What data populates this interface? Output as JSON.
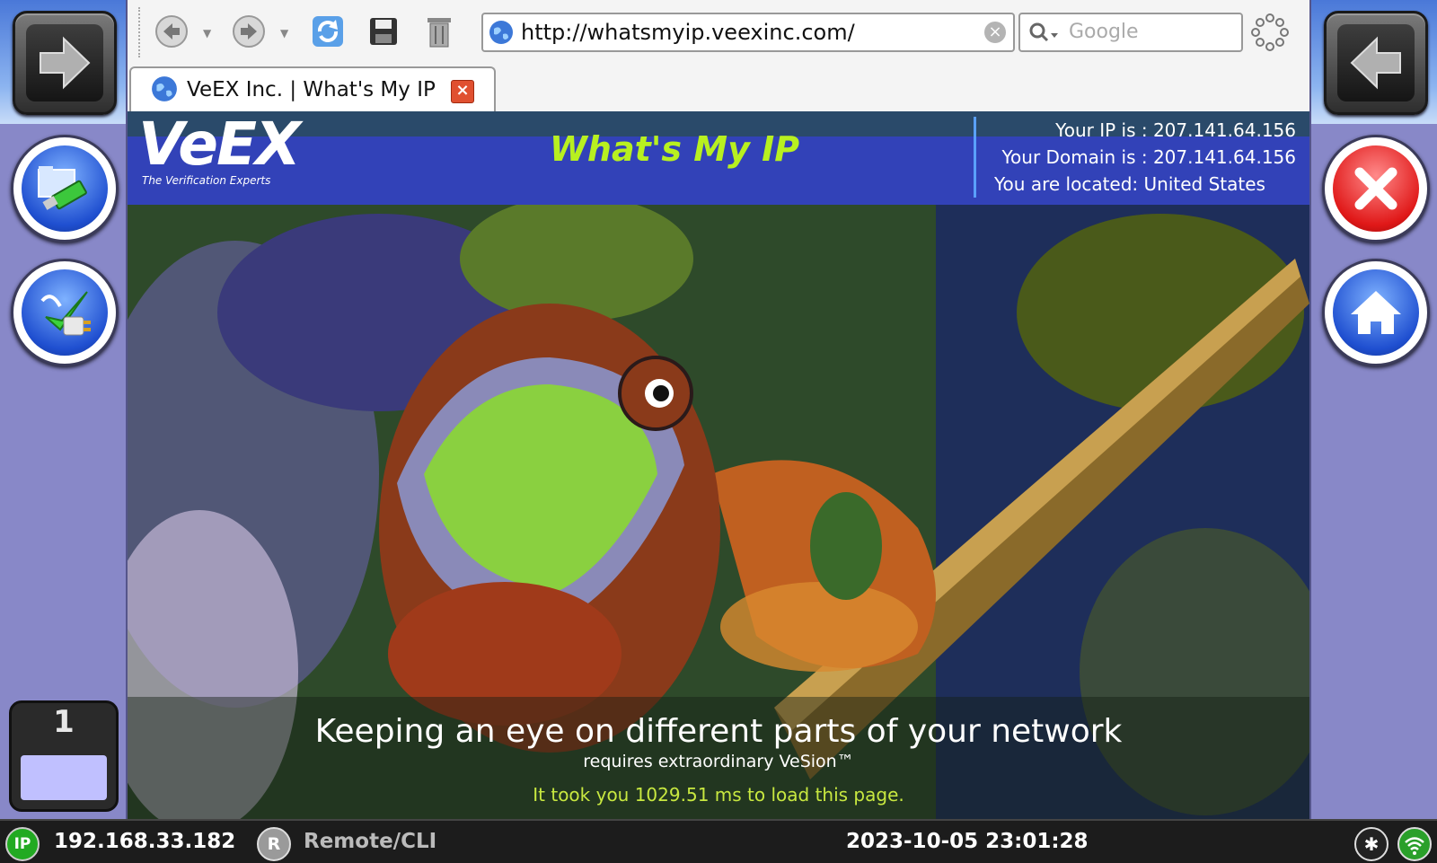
{
  "browser": {
    "url": "http://whatsmyip.veexinc.com/",
    "search_placeholder": "Google",
    "tab_title": "VeEX Inc. | What's My IP"
  },
  "page": {
    "logo_text": "VeEX",
    "logo_tagline": "The Verification Experts",
    "title": "What's My IP",
    "ip_line": "Your IP is : 207.141.64.156",
    "domain_line": "Your Domain is : 207.141.64.156",
    "location_line": "You are located: United States",
    "headline": "Keeping an eye on different parts of your network",
    "subline": "requires extraordinary VeSion™",
    "load_time": "It took you 1029.51 ms to load this page."
  },
  "side": {
    "counter_value": "1"
  },
  "status": {
    "ip_badge": "IP",
    "ip_address": "192.168.33.182",
    "remote_badge": "R",
    "remote_label": "Remote/CLI",
    "datetime": "2023-10-05  23:01:28"
  },
  "colors": {
    "accent_green": "#b8f020",
    "banner_blue": "#3242b8",
    "close_red": "#e01818"
  }
}
